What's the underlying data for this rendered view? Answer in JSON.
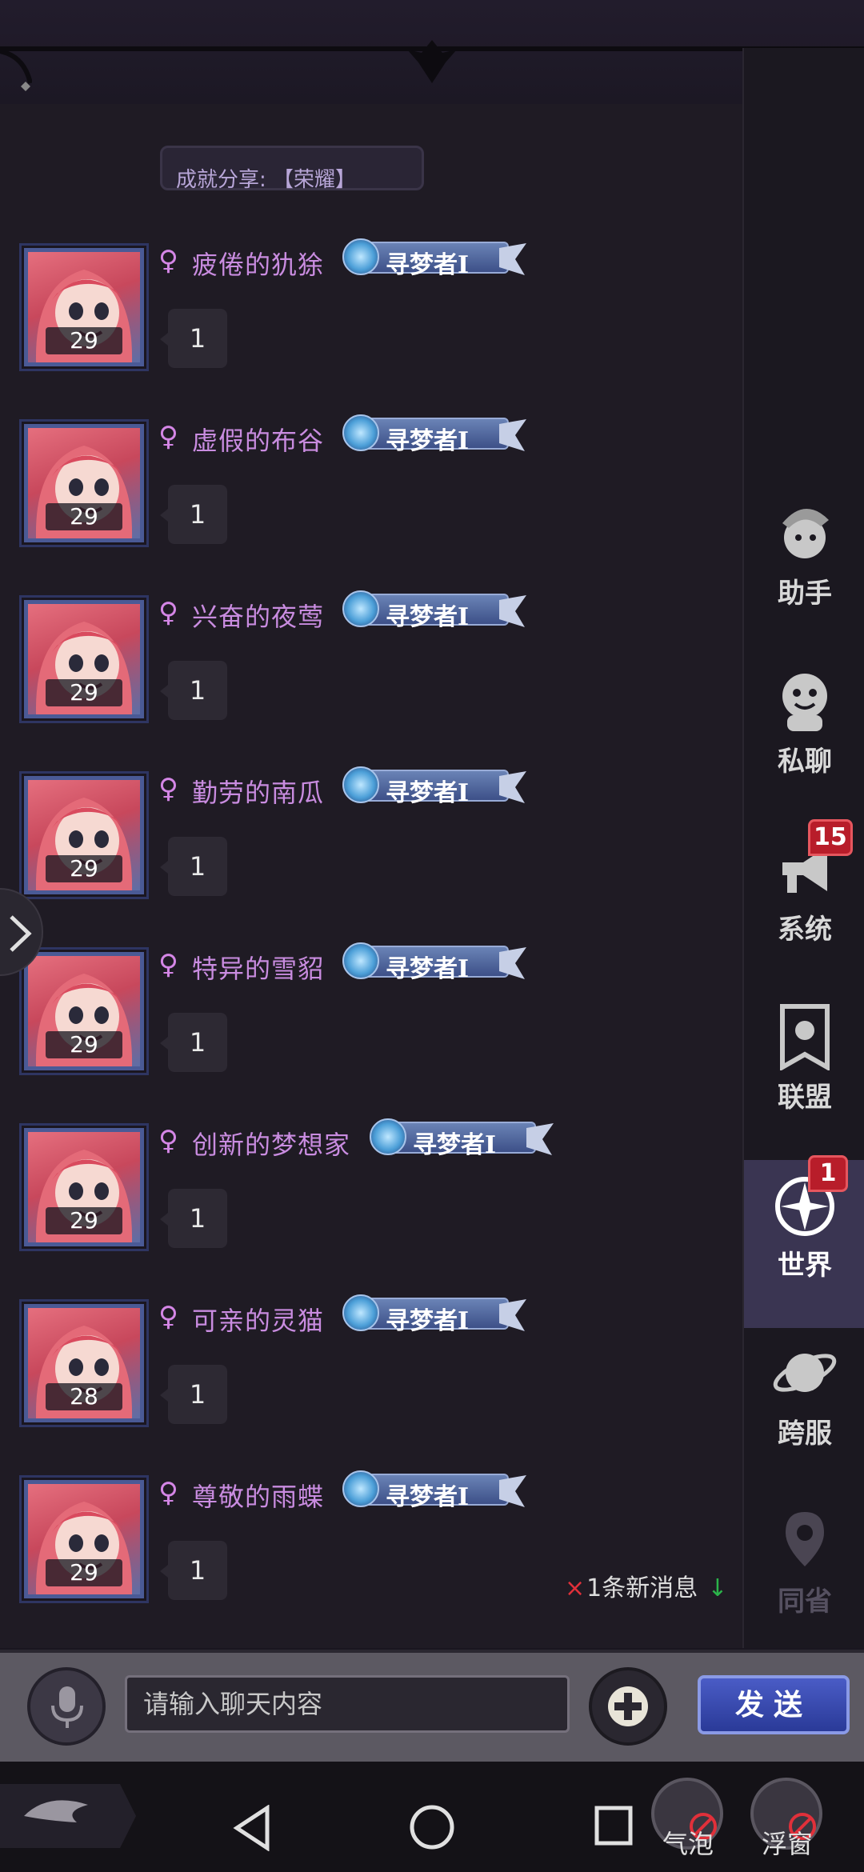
{
  "partial_message": {
    "text": "成就分享: 【荣耀】"
  },
  "messages": [
    {
      "gender": "♀",
      "name": "疲倦的犰狳",
      "badge": "寻梦者Ⅰ",
      "level": "29",
      "text": "1"
    },
    {
      "gender": "♀",
      "name": "虚假的布谷",
      "badge": "寻梦者Ⅰ",
      "level": "29",
      "text": "1"
    },
    {
      "gender": "♀",
      "name": "兴奋的夜莺",
      "badge": "寻梦者Ⅰ",
      "level": "29",
      "text": "1"
    },
    {
      "gender": "♀",
      "name": "勤劳的南瓜",
      "badge": "寻梦者Ⅰ",
      "level": "29",
      "text": "1"
    },
    {
      "gender": "♀",
      "name": "特异的雪貂",
      "badge": "寻梦者Ⅰ",
      "level": "29",
      "text": "1"
    },
    {
      "gender": "♀",
      "name": "创新的梦想家",
      "badge": "寻梦者Ⅰ",
      "level": "29",
      "text": "1"
    },
    {
      "gender": "♀",
      "name": "可亲的灵猫",
      "badge": "寻梦者Ⅰ",
      "level": "28",
      "text": "1"
    },
    {
      "gender": "♀",
      "name": "尊敬的雨蝶",
      "badge": "寻梦者Ⅰ",
      "level": "29",
      "text": "1"
    }
  ],
  "new_message": {
    "x": "×",
    "text": "1条新消息",
    "arrow": "↓"
  },
  "tabs": [
    {
      "label": "助手",
      "icon": "assistant-icon",
      "badge": null
    },
    {
      "label": "私聊",
      "icon": "private-chat-icon",
      "badge": null
    },
    {
      "label": "系统",
      "icon": "megaphone-icon",
      "badge": "15"
    },
    {
      "label": "联盟",
      "icon": "alliance-banner-icon",
      "badge": null
    },
    {
      "label": "世界",
      "icon": "compass-icon",
      "badge": "1",
      "active": true
    },
    {
      "label": "跨服",
      "icon": "planet-icon",
      "badge": null
    },
    {
      "label": "同省",
      "icon": "location-pin-icon",
      "badge": null
    }
  ],
  "input": {
    "placeholder": "请输入聊天内容",
    "send_label": "发送"
  },
  "floating": {
    "bubble_label": "气泡",
    "window_label": "浮窗"
  },
  "colors": {
    "name": "#c98ce0",
    "accent": "#3a3552",
    "badge_red": "#b81d2a",
    "send": "#2a3a98"
  }
}
